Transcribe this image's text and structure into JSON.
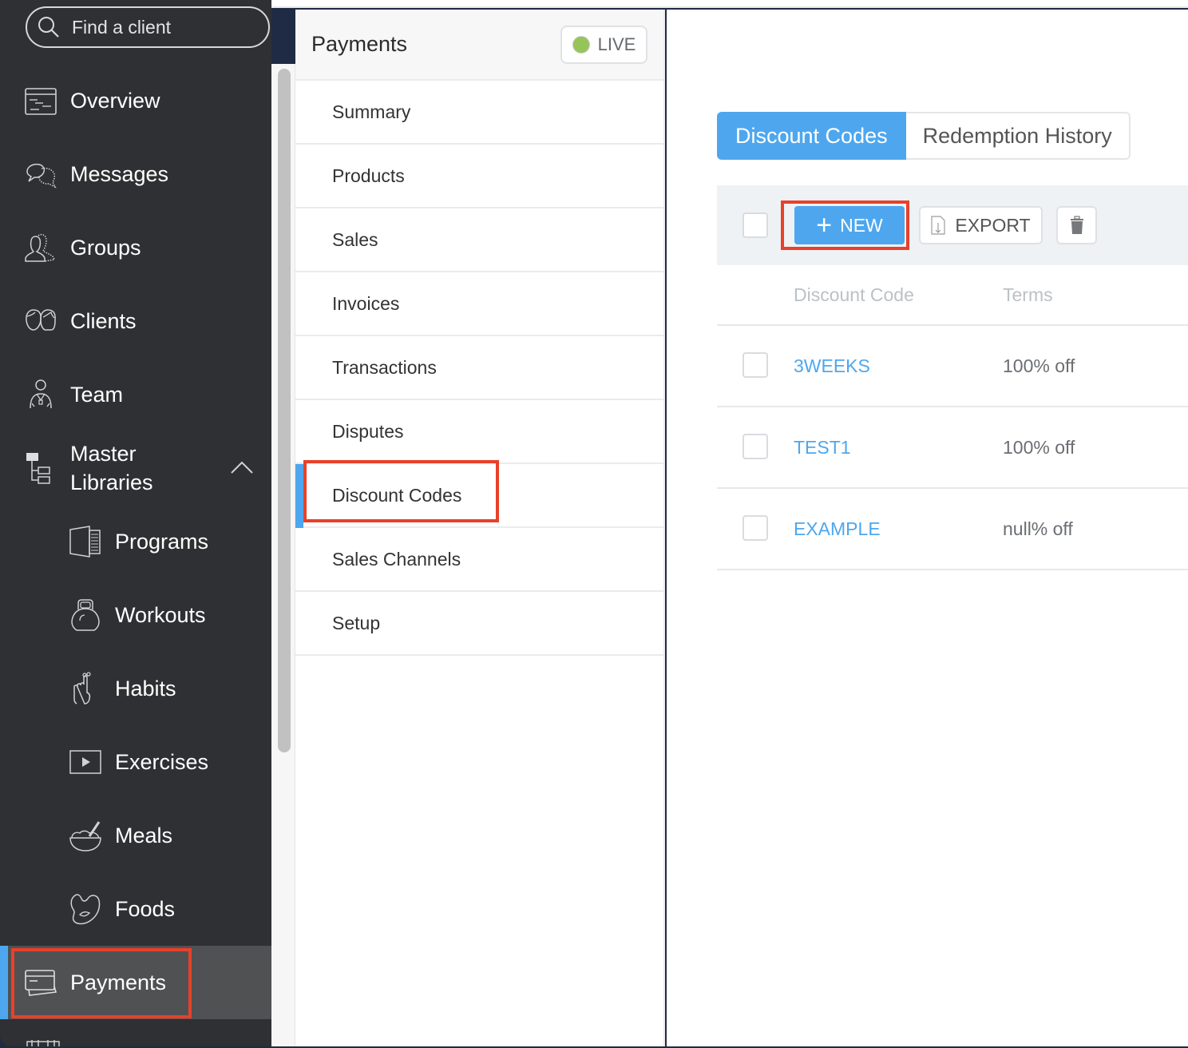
{
  "sidebar": {
    "search_placeholder": "Find a client",
    "items": [
      {
        "label": "Overview",
        "icon": "overview-icon"
      },
      {
        "label": "Messages",
        "icon": "messages-icon"
      },
      {
        "label": "Groups",
        "icon": "groups-icon"
      },
      {
        "label": "Clients",
        "icon": "clients-icon"
      },
      {
        "label": "Team",
        "icon": "team-icon"
      },
      {
        "label": "Master\nLibraries",
        "icon": "libraries-icon",
        "expanded": true
      },
      {
        "label": "Programs",
        "icon": "programs-icon"
      },
      {
        "label": "Workouts",
        "icon": "kettlebell-icon"
      },
      {
        "label": "Habits",
        "icon": "habit-finger-icon"
      },
      {
        "label": "Exercises",
        "icon": "video-play-icon"
      },
      {
        "label": "Meals",
        "icon": "bowl-icon"
      },
      {
        "label": "Foods",
        "icon": "bean-icon"
      },
      {
        "label": "Payments",
        "icon": "credit-card-icon",
        "active": true
      }
    ],
    "master_libraries_line1": "Master",
    "master_libraries_line2": "Libraries"
  },
  "subnav": {
    "title": "Payments",
    "status_label": "LIVE",
    "status_color": "#97c459",
    "items": [
      "Summary",
      "Products",
      "Sales",
      "Invoices",
      "Transactions",
      "Disputes",
      "Discount Codes",
      "Sales Channels",
      "Setup"
    ],
    "active_index": 6
  },
  "main": {
    "tabs": [
      {
        "label": "Discount Codes",
        "active": true
      },
      {
        "label": "Redemption History",
        "active": false
      }
    ],
    "toolbar": {
      "new_label": "NEW",
      "export_label": "EXPORT"
    },
    "table": {
      "columns": [
        "Discount Code",
        "Terms"
      ],
      "rows": [
        {
          "code": "3WEEKS",
          "terms": "100% off"
        },
        {
          "code": "TEST1",
          "terms": "100% off"
        },
        {
          "code": "EXAMPLE",
          "terms": "null% off"
        }
      ]
    }
  },
  "colors": {
    "accent": "#4ea7ee",
    "sidebar_bg": "#2f3033",
    "highlight": "#e8412a"
  }
}
